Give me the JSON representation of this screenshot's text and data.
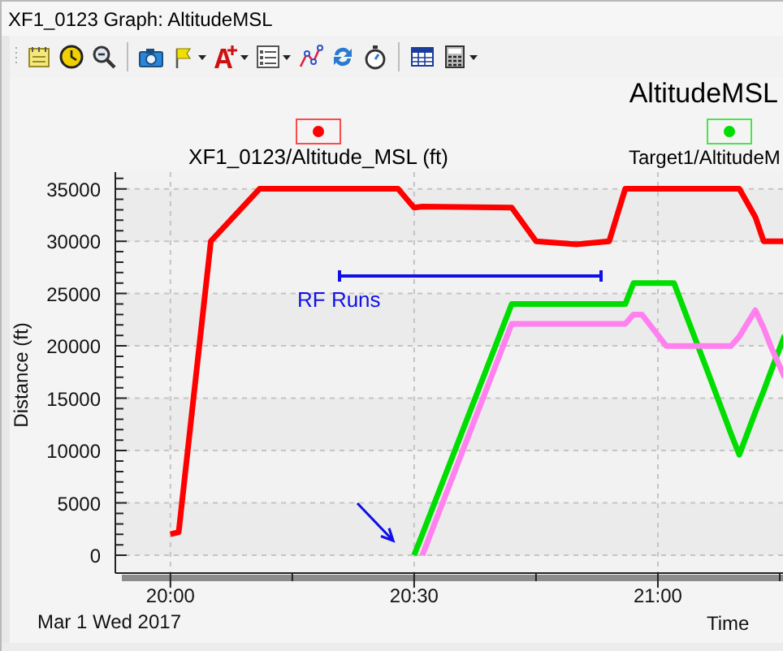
{
  "window": {
    "title": "XF1_0123 Graph: AltitudeMSL"
  },
  "chart": {
    "title": "AltitudeMSL",
    "date_label": "Mar 1 Wed 2017",
    "chart_data": {
      "type": "line",
      "xlabel": "Time",
      "ylabel": "Distance (ft)",
      "grid": true,
      "legend": "top",
      "x": [
        20,
        20.017,
        20.083,
        20.183,
        20.467,
        20.5,
        20.517,
        20.7,
        20.75,
        20.833,
        20.9,
        20.933,
        20.95,
        20.967,
        21.017,
        21.033,
        21.1,
        21.15,
        21.167,
        21.2,
        21.217,
        21.233,
        21.26
      ],
      "series": [
        {
          "name": "XF1_0123/Altitude_MSL (ft)",
          "color": "#ff0000",
          "values": [
            2000,
            2200,
            30000,
            35000,
            35000,
            33200,
            33300,
            33200,
            30000,
            29700,
            30000,
            35000,
            35000,
            35000,
            35000,
            35000,
            35000,
            35000,
            35000,
            32300,
            30000,
            30000,
            30000
          ]
        },
        {
          "name": "Target1/AltitudeM",
          "color": "#00dd00",
          "values": [
            null,
            null,
            null,
            null,
            null,
            0,
            2000,
            24000,
            24000,
            24000,
            24000,
            24000,
            26000,
            26000,
            26000,
            26000,
            17800,
            11600,
            9600,
            13700,
            15700,
            17700,
            21000
          ]
        },
        {
          "color": "#ff80ee",
          "values": [
            null,
            null,
            null,
            null,
            null,
            null,
            0,
            22100,
            22100,
            22100,
            22100,
            22100,
            23000,
            23000,
            20000,
            20000,
            20000,
            20000,
            20900,
            23400,
            21700,
            19800,
            17000
          ]
        }
      ],
      "xlim": [
        19.887,
        21.26
      ],
      "ylim": [
        -1700,
        36600
      ],
      "xticks": [
        {
          "value": 20,
          "label": "20:00"
        },
        {
          "value": 20.5,
          "label": "20:30"
        },
        {
          "value": 21,
          "label": "21:00"
        }
      ],
      "yticks": [
        0,
        5000,
        10000,
        15000,
        20000,
        25000,
        30000,
        35000
      ],
      "annotations": [
        "RF Runs"
      ]
    }
  }
}
